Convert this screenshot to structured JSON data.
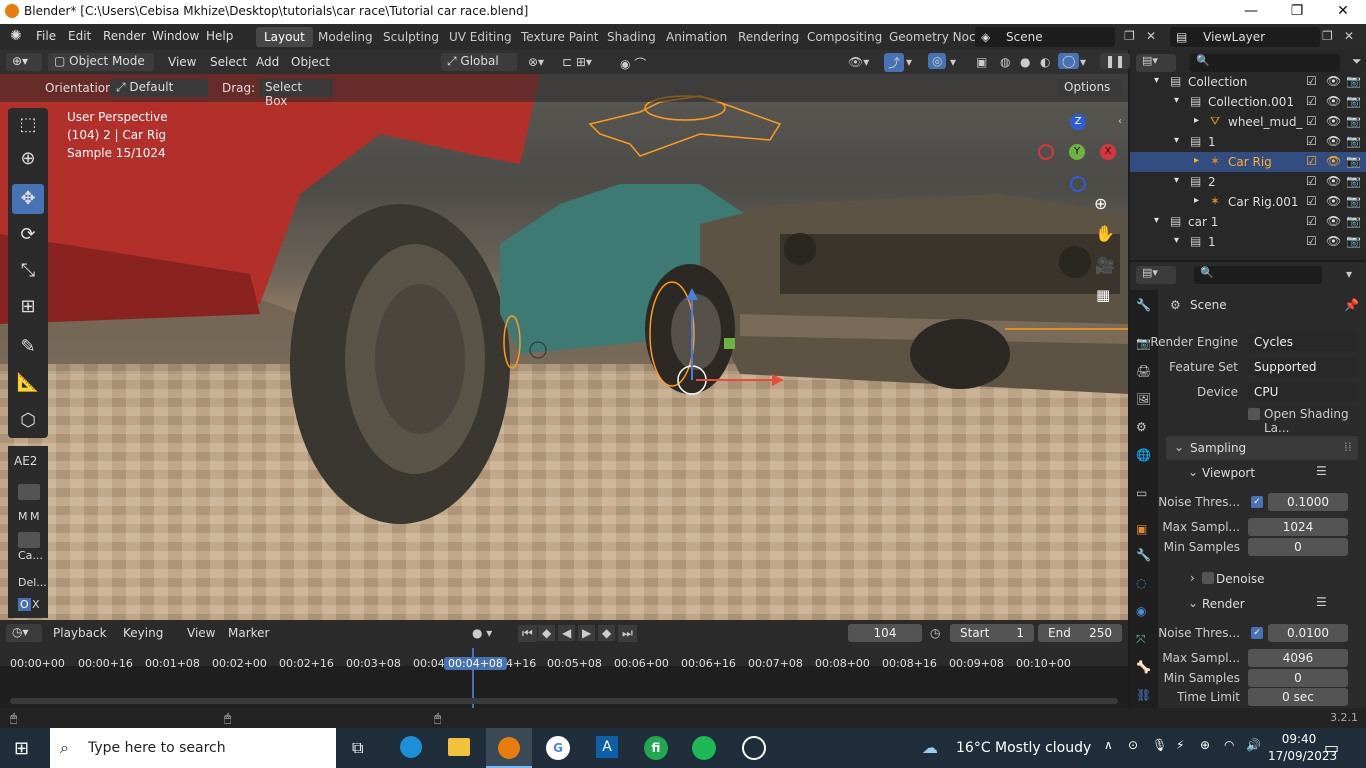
{
  "window": {
    "title": "Blender* [C:\\Users\\Cebisa Mkhize\\Desktop\\tutorials\\car race\\Tutorial car race.blend]"
  },
  "menu": {
    "items": [
      "File",
      "Edit",
      "Render",
      "Window",
      "Help"
    ],
    "workspaces": [
      "Layout",
      "Modeling",
      "Sculpting",
      "UV Editing",
      "Texture Paint",
      "Shading",
      "Animation",
      "Rendering",
      "Compositing",
      "Geometry Noc"
    ],
    "scene": "Scene",
    "view_layer": "ViewLayer"
  },
  "viewport_header": {
    "mode": "Object Mode",
    "menus": [
      "View",
      "Select",
      "Add",
      "Object"
    ],
    "transform": "Global"
  },
  "tool_header": {
    "orientation_label": "Orientation:",
    "orientation_value": "Default",
    "drag_label": "Drag:",
    "drag_value": "Select Box",
    "options": "Options"
  },
  "viewport": {
    "perspective": "User Perspective",
    "object": "(104) 2 | Car Rig",
    "sample": "Sample 15/1024",
    "axes": {
      "z": "Z",
      "y": "Y",
      "x": "X"
    },
    "panel": {
      "title": "AE2",
      "m1": "M",
      "m2": "M",
      "ca": "Ca...",
      "del": "Del...",
      "o": "O",
      "x": "X"
    }
  },
  "timeline": {
    "menus": [
      "Playback",
      "Keying",
      "View",
      "Marker"
    ],
    "current_frame": "104",
    "start_label": "Start",
    "start": "1",
    "end_label": "End",
    "end": "250",
    "ticks": [
      "00:00+00",
      "00:00+16",
      "00:01+08",
      "00:02+00",
      "00:02+16",
      "00:03+08",
      "00:04",
      "00:04+08",
      "4+16",
      "00:05+08",
      "00:06+00",
      "00:06+16",
      "00:07+08",
      "00:08+00",
      "00:08+16",
      "00:09+08",
      "00:10+00"
    ],
    "playhead": "00:04+08"
  },
  "outliner": {
    "rows": [
      {
        "label": "Collection",
        "indent": 0
      },
      {
        "label": "Collection.001",
        "indent": 1
      },
      {
        "label": "wheel_mud_",
        "indent": 2
      },
      {
        "label": "1",
        "indent": 1
      },
      {
        "label": "Car Rig",
        "indent": 2,
        "selected": true
      },
      {
        "label": "2",
        "indent": 1
      },
      {
        "label": "Car Rig.001",
        "indent": 2
      },
      {
        "label": "car 1",
        "indent": 0
      },
      {
        "label": "1",
        "indent": 1
      }
    ]
  },
  "properties": {
    "context": "Scene",
    "render_engine_label": "Render Engine",
    "render_engine": "Cycles",
    "feature_set_label": "Feature Set",
    "feature_set": "Supported",
    "device_label": "Device",
    "device": "CPU",
    "osl": "Open Shading La...",
    "sampling": "Sampling",
    "viewport": "Viewport",
    "v_noise_label": "Noise Thres...",
    "v_noise": "0.1000",
    "v_max_label": "Max Sampl...",
    "v_max": "1024",
    "v_min_label": "Min Samples",
    "v_min": "0",
    "denoise": "Denoise",
    "render": "Render",
    "r_noise_label": "Noise Thres...",
    "r_noise": "0.0100",
    "r_max_label": "Max Sampl...",
    "r_max": "4096",
    "r_min_label": "Min Samples",
    "r_min": "0",
    "time_label": "Time Limit",
    "time": "0 sec"
  },
  "status": {
    "version": "3.2.1"
  },
  "taskbar": {
    "search": "Type here to search",
    "weather": "16°C  Mostly cloudy",
    "time": "09:40",
    "date": "17/09/2023"
  },
  "colors": {
    "accent": "#4772b3",
    "selection": "#ffaf29",
    "header": "#303030",
    "panel": "#2b2b2b"
  }
}
